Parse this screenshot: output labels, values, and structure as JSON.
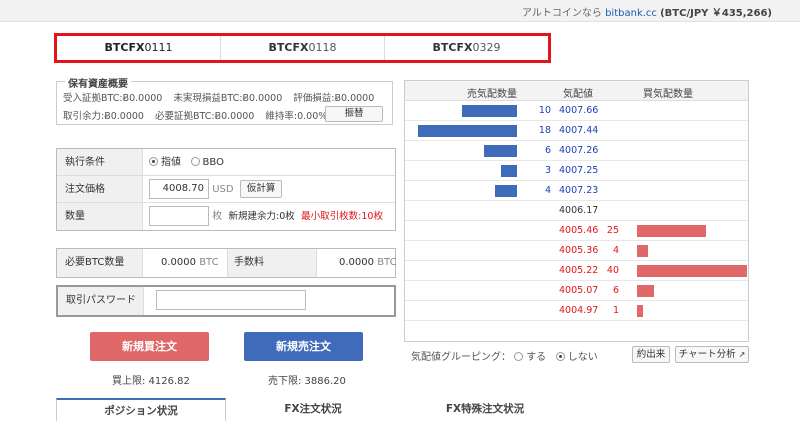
{
  "topbar": {
    "text": "アルトコインなら",
    "link": "bitbank.cc",
    "rate": "(BTC/JPY ￥435,266)"
  },
  "pair_tabs": [
    {
      "bold": "BTCFX",
      "rest": "0111",
      "active": true
    },
    {
      "bold": "BTCFX",
      "rest": "0118",
      "active": false
    },
    {
      "bold": "BTCFX",
      "rest": "0329",
      "active": false
    }
  ],
  "holdings": {
    "title": "保有資産概要",
    "row1": [
      "受入証拠BTC:Ƀ0.0000",
      "未実現損益BTC:Ƀ0.0000",
      "評価損益:Ƀ0.0000"
    ],
    "row2": [
      "取引余力:Ƀ0.0000",
      "必要証拠BTC:Ƀ0.0000",
      "維持率:0.00%"
    ],
    "swap_label": "振替"
  },
  "order_form": {
    "condition_label": "執行条件",
    "limit_option": "指値",
    "bbo_option": "BBO",
    "price_label": "注文価格",
    "price_value": "4008.70",
    "price_unit": "USD",
    "calc_button": "仮計算",
    "qty_label": "数量",
    "qty_value": "",
    "qty_unit": "枚",
    "new_capacity": "新規建余力:0枚",
    "min_qty": "最小取引枚数:10枚",
    "need_btc_label": "必要BTC数量",
    "need_btc_value": "0.0000",
    "need_btc_unit": "BTC",
    "fee_label": "手数料",
    "fee_value": "0.0000",
    "fee_unit": "BTC",
    "password_label": "取引パスワード",
    "password_value": ""
  },
  "actions": {
    "buy_label": "新規買注文",
    "sell_label": "新規売注文",
    "buy_limit": "買上限: 4126.82",
    "sell_limit": "売下限: 3886.20"
  },
  "bottom_tabs": [
    "ポジション状況",
    "FX注文状況",
    "FX特殊注文状況"
  ],
  "order_book": {
    "headers": {
      "sell": "売気配数量",
      "price": "気配値",
      "buy": "買気配数量"
    },
    "asks": [
      {
        "qty": 10,
        "price": "4007.66"
      },
      {
        "qty": 18,
        "price": "4007.44"
      },
      {
        "qty": 6,
        "price": "4007.26"
      },
      {
        "qty": 3,
        "price": "4007.25"
      },
      {
        "qty": 4,
        "price": "4007.23"
      }
    ],
    "mid": "4006.17",
    "bids": [
      {
        "qty": 25,
        "price": "4005.46"
      },
      {
        "qty": 4,
        "price": "4005.36"
      },
      {
        "qty": 40,
        "price": "4005.22"
      },
      {
        "qty": 6,
        "price": "4005.07"
      },
      {
        "qty": 1,
        "price": "4004.97"
      }
    ],
    "grouping_label": "気配値グルーピング：",
    "grouping_on": "する",
    "grouping_off": "しない",
    "trades_button": "約出来",
    "chart_button": "チャート分析"
  },
  "colors": {
    "buy": "#e06868",
    "sell": "#3f6bba",
    "highlight": "#e0161a"
  }
}
